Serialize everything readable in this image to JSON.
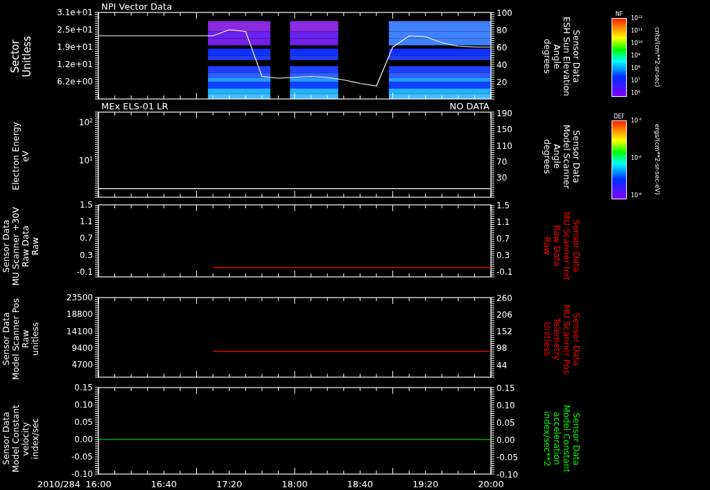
{
  "panels": [
    {
      "title": "NPI Vector Data",
      "left_label": [
        "Sector",
        "Unitless"
      ],
      "right_label": [
        "Sensor Data",
        "ESH Sun Elevation",
        "Angle",
        "degrees"
      ],
      "left_ticks": [
        "3.1e+01",
        "2.5e+01",
        "1.9e+01",
        "1.2e+01",
        "6.2e+00"
      ],
      "spectrogram": true,
      "chart_data": {
        "type": "line",
        "categories": [
          null,
          null,
          null,
          null,
          null,
          null,
          null,
          null,
          null,
          null,
          null,
          null,
          null,
          null,
          null,
          null,
          null,
          null,
          null,
          null,
          null,
          null,
          null,
          null,
          null
        ],
        "ylim": [
          0,
          100
        ],
        "yticks": [
          {
            "value": 100,
            "label": "100"
          },
          {
            "value": 80,
            "label": "80"
          },
          {
            "value": 60,
            "label": "60"
          },
          {
            "value": 40,
            "label": "40"
          },
          {
            "value": 20,
            "label": "20"
          }
        ],
        "series": [
          {
            "color": "#ffffff",
            "values": [
              73,
              73,
              73,
              73,
              73,
              73,
              73,
              73,
              80,
              78,
              26,
              24,
              25,
              26,
              25,
              22,
              18,
              15,
              60,
              73,
              72,
              65,
              61,
              60,
              60
            ]
          }
        ]
      }
    },
    {
      "title": "MEx ELS-01 LR",
      "right_title": "NO DATA",
      "left_label": [
        "Electron Energy",
        "eV"
      ],
      "right_label": [
        "Sensor Data",
        "Model Scanner",
        "Angle",
        "degrees"
      ],
      "left_ticks": [
        "10$^{2}$",
        "10$^{1}$"
      ],
      "spectrogram": false,
      "chart_data": {
        "type": "line",
        "categories": [
          null,
          null,
          null,
          null,
          null,
          null,
          null,
          null,
          null,
          null,
          null,
          null,
          null,
          null,
          null,
          null,
          null,
          null,
          null,
          null,
          null,
          null,
          null,
          null,
          null
        ],
        "ylim": [
          -18,
          192
        ],
        "yticks": [
          {
            "value": 190,
            "label": "190"
          },
          {
            "value": 150,
            "label": "150"
          },
          {
            "value": 110,
            "label": "110"
          },
          {
            "value": 70,
            "label": "70"
          },
          {
            "value": 30,
            "label": "30"
          }
        ],
        "series": [
          {
            "color": "#ffffff",
            "values": [
              3,
              3,
              3,
              3,
              3,
              3,
              3,
              3,
              3,
              3,
              3,
              3,
              3,
              3,
              3,
              3,
              3,
              3,
              3,
              3,
              3,
              3,
              3,
              3,
              3
            ]
          }
        ]
      }
    },
    {
      "left_label": [
        "Sensor Data",
        "MU Scanner +30V",
        "Raw Data",
        "Raw"
      ],
      "right_label": [
        "Sensor Data",
        "MU Scanner Init",
        "Raw Data",
        "Raw"
      ],
      "left_ticks": [
        "1.5",
        "1.1",
        "0.7",
        "0.3",
        "-0.1"
      ],
      "spectrogram": false,
      "chart_data": {
        "type": "line",
        "categories": [
          null,
          null,
          null,
          null,
          null,
          null,
          null,
          null,
          null,
          null,
          null,
          null,
          null,
          null,
          null,
          null,
          null,
          null,
          null,
          null,
          null,
          null,
          null,
          null,
          null
        ],
        "ylim": [
          -0.22,
          1.5
        ],
        "yticks": [
          {
            "value": 1.5,
            "label": "1.5"
          },
          {
            "value": 1.1,
            "label": "1.1"
          },
          {
            "value": 0.7,
            "label": "0.7"
          },
          {
            "value": 0.3,
            "label": "0.3"
          },
          {
            "value": -0.1,
            "label": "-0.1"
          }
        ],
        "series": [
          {
            "color": "#ff0000",
            "values": [
              null,
              null,
              null,
              null,
              null,
              null,
              null,
              0,
              0,
              0,
              0,
              0,
              0,
              0,
              0,
              0,
              0,
              0,
              0,
              0,
              0,
              0,
              0,
              0,
              0
            ]
          }
        ]
      }
    },
    {
      "left_label": [
        "Sensor Data",
        "Model Scanner Pos",
        "Raw",
        "unitless"
      ],
      "right_label": [
        "Sensor Data",
        "MU Scanner Pos",
        "Telemetry",
        "Unitless"
      ],
      "left_ticks": [
        "23500",
        "18800",
        "14100",
        "9400",
        "4700"
      ],
      "spectrogram": false,
      "chart_data": {
        "type": "line",
        "categories": [
          null,
          null,
          null,
          null,
          null,
          null,
          null,
          null,
          null,
          null,
          null,
          null,
          null,
          null,
          null,
          null,
          null,
          null,
          null,
          null,
          null,
          null,
          null,
          null,
          null
        ],
        "ylim": [
          4,
          260
        ],
        "yticks": [
          {
            "value": 260,
            "label": "260"
          },
          {
            "value": 206,
            "label": "206"
          },
          {
            "value": 152,
            "label": "152"
          },
          {
            "value": 98,
            "label": "98"
          },
          {
            "value": 44,
            "label": "44"
          }
        ],
        "series": [
          {
            "color": "#ff0000",
            "values": [
              null,
              null,
              null,
              null,
              null,
              null,
              null,
              87,
              87,
              87,
              87,
              87,
              87,
              87,
              87,
              87,
              87,
              87,
              87,
              87,
              87,
              87,
              87,
              87,
              87
            ]
          }
        ]
      }
    },
    {
      "left_label": [
        "Sensor Data",
        "Model Constant",
        "velocity",
        "index/sec"
      ],
      "right_label": [
        "Sensor Data",
        "Model Constant",
        "acceleration",
        "index/sec**2"
      ],
      "left_ticks": [
        "0.15",
        "0.10",
        "0.05",
        "0.00",
        "-0.05",
        "-0.10"
      ],
      "spectrogram": false,
      "chart_data": {
        "type": "line",
        "categories": [
          "16:00",
          null,
          null,
          null,
          "16:40",
          null,
          null,
          null,
          "17:20",
          null,
          null,
          null,
          "18:00",
          null,
          null,
          null,
          "18:40",
          null,
          null,
          null,
          "19:20",
          null,
          null,
          null,
          "20:00"
        ],
        "ylim": [
          -0.1,
          0.15
        ],
        "yticks": [
          {
            "value": 0.15,
            "label": "0.15"
          },
          {
            "value": 0.1,
            "label": "0.10"
          },
          {
            "value": 0.05,
            "label": "0.05"
          },
          {
            "value": 0,
            "label": "0.00"
          },
          {
            "value": -0.05,
            "label": "-0.05"
          },
          {
            "value": -0.1,
            "label": "-0.10"
          }
        ],
        "series": [
          {
            "color": "#00ff00",
            "values": [
              0,
              0,
              0,
              0,
              0,
              0,
              0,
              0,
              0,
              0,
              0,
              0,
              0,
              0,
              0,
              0,
              0,
              0,
              0,
              0,
              0,
              0,
              0,
              0,
              0
            ]
          }
        ]
      }
    }
  ],
  "x_axis": {
    "date": "2010/284"
  },
  "colorbars": [
    {
      "title": "NF",
      "ticks": [
        "10$^{12}$",
        "10$^{11}$",
        "10$^{10}$",
        "10$^{9}$",
        "10$^{8}$",
        "10$^{7}$",
        "10$^{6}$"
      ],
      "units": "cnts/(cm**2-sr-sec)"
    },
    {
      "title": "DEF",
      "ticks": [
        "10$^{-4}$",
        "10$^{-6}$",
        "10$^{-8}$"
      ],
      "units": "ergs/(cm**2-sr-sec-eV)"
    }
  ]
}
